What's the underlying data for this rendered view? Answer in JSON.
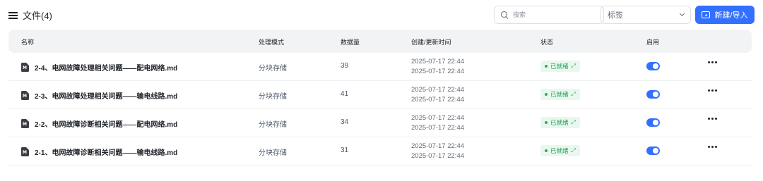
{
  "header": {
    "title": "文件(4)",
    "search_placeholder": "搜索",
    "tag_select_label": "标签",
    "new_button_label": "新建/导入"
  },
  "table": {
    "columns": [
      "名称",
      "处理模式",
      "数据量",
      "创建/更新时间",
      "状态",
      "启用"
    ],
    "rows": [
      {
        "name": "2-4、电网故障处理相关问题——配电网络.md",
        "mode": "分块存储",
        "count": "39",
        "created": "2025-07-17 22:44",
        "updated": "2025-07-17 22:44",
        "status": "已就绪",
        "enabled": true
      },
      {
        "name": "2-3、电网故障处理相关问题——输电线路.md",
        "mode": "分块存储",
        "count": "41",
        "created": "2025-07-17 22:44",
        "updated": "2025-07-17 22:44",
        "status": "已就绪",
        "enabled": true
      },
      {
        "name": "2-2、电网故障诊断相关问题——配电网络.md",
        "mode": "分块存储",
        "count": "34",
        "created": "2025-07-17 22:44",
        "updated": "2025-07-17 22:44",
        "status": "已就绪",
        "enabled": true
      },
      {
        "name": "2-1、电网故障诊断相关问题——输电线路.md",
        "mode": "分块存储",
        "count": "31",
        "created": "2025-07-17 22:44",
        "updated": "2025-07-17 22:44",
        "status": "已就绪",
        "enabled": true
      }
    ]
  },
  "colors": {
    "primary": "#3370ff",
    "status_bg": "#e8f8ee",
    "status_text": "#1f9d55",
    "header_bg": "#f2f3f5"
  },
  "icons": {
    "title": "list-icon",
    "search": "search-icon",
    "select": "chevron-down-icon",
    "new": "folder-add-icon",
    "file": "markdown-file-icon",
    "status": "expand-icon",
    "actions": "more-icon"
  }
}
